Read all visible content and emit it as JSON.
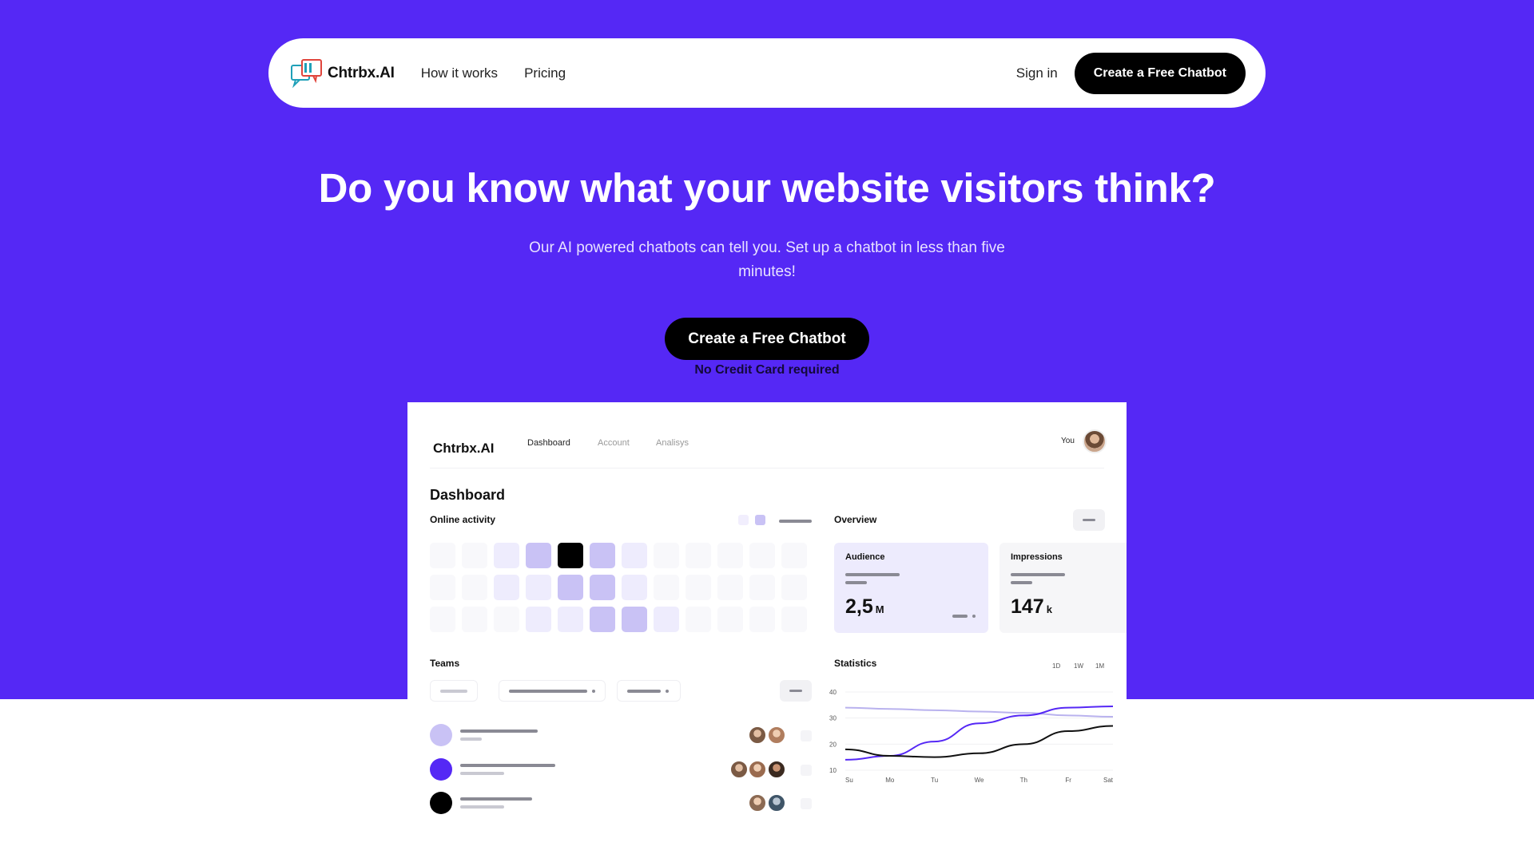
{
  "colors": {
    "brand": "#5528f5",
    "black": "#000000",
    "lavender": "#c9c2f5",
    "lavender_light": "#edebfd"
  },
  "nav": {
    "logo_text": "Chtrbx.AI",
    "links": [
      "How it works",
      "Pricing"
    ],
    "signin": "Sign in",
    "cta": "Create a Free Chatbot"
  },
  "hero": {
    "title": "Do you know what your website visitors think?",
    "subtitle": "Our AI powered chatbots can tell you. Set up a chatbot in less than five minutes!",
    "cta": "Create a Free Chatbot",
    "note": "No Credit Card required"
  },
  "dashboard": {
    "brand": "Chtrbx.AI",
    "tabs": [
      "Dashboard",
      "Account",
      "Analisys"
    ],
    "active_tab": "Dashboard",
    "user_label": "You",
    "heading": "Dashboard",
    "online_activity": {
      "title": "Online activity",
      "levels": [
        [
          0,
          0,
          1,
          2,
          3,
          2,
          1,
          0,
          0,
          0,
          0,
          0
        ],
        [
          0,
          0,
          1,
          1,
          2,
          2,
          1,
          0,
          0,
          0,
          0,
          0
        ],
        [
          0,
          0,
          0,
          1,
          1,
          2,
          2,
          1,
          0,
          0,
          0,
          0
        ]
      ]
    },
    "overview": {
      "title": "Overview",
      "cards": [
        {
          "title": "Audience",
          "value": "2,5",
          "unit": "M"
        },
        {
          "title": "Impressions",
          "value": "147",
          "unit": "k"
        }
      ]
    },
    "teams": {
      "title": "Teams",
      "rows": [
        "lavender",
        "brand",
        "black"
      ]
    },
    "statistics": {
      "title": "Statistics",
      "ranges": [
        "1D",
        "1W",
        "1M"
      ]
    }
  },
  "chart_data": {
    "type": "line",
    "title": "Statistics",
    "categories": [
      "Su",
      "Mo",
      "Tu",
      "We",
      "Th",
      "Fr",
      "Sat"
    ],
    "yticks": [
      10,
      20,
      30,
      40
    ],
    "ylim": [
      10,
      40
    ],
    "grid": true,
    "series": [
      {
        "color": "#b9b2ee",
        "values": [
          34,
          33.5,
          33,
          32.5,
          32,
          31,
          30.5
        ]
      },
      {
        "color": "#5528f5",
        "values": [
          14,
          15.5,
          21,
          28,
          31,
          34,
          34.5
        ]
      },
      {
        "color": "#111111",
        "values": [
          18,
          15.5,
          15,
          16.5,
          20,
          25,
          27
        ]
      }
    ]
  }
}
